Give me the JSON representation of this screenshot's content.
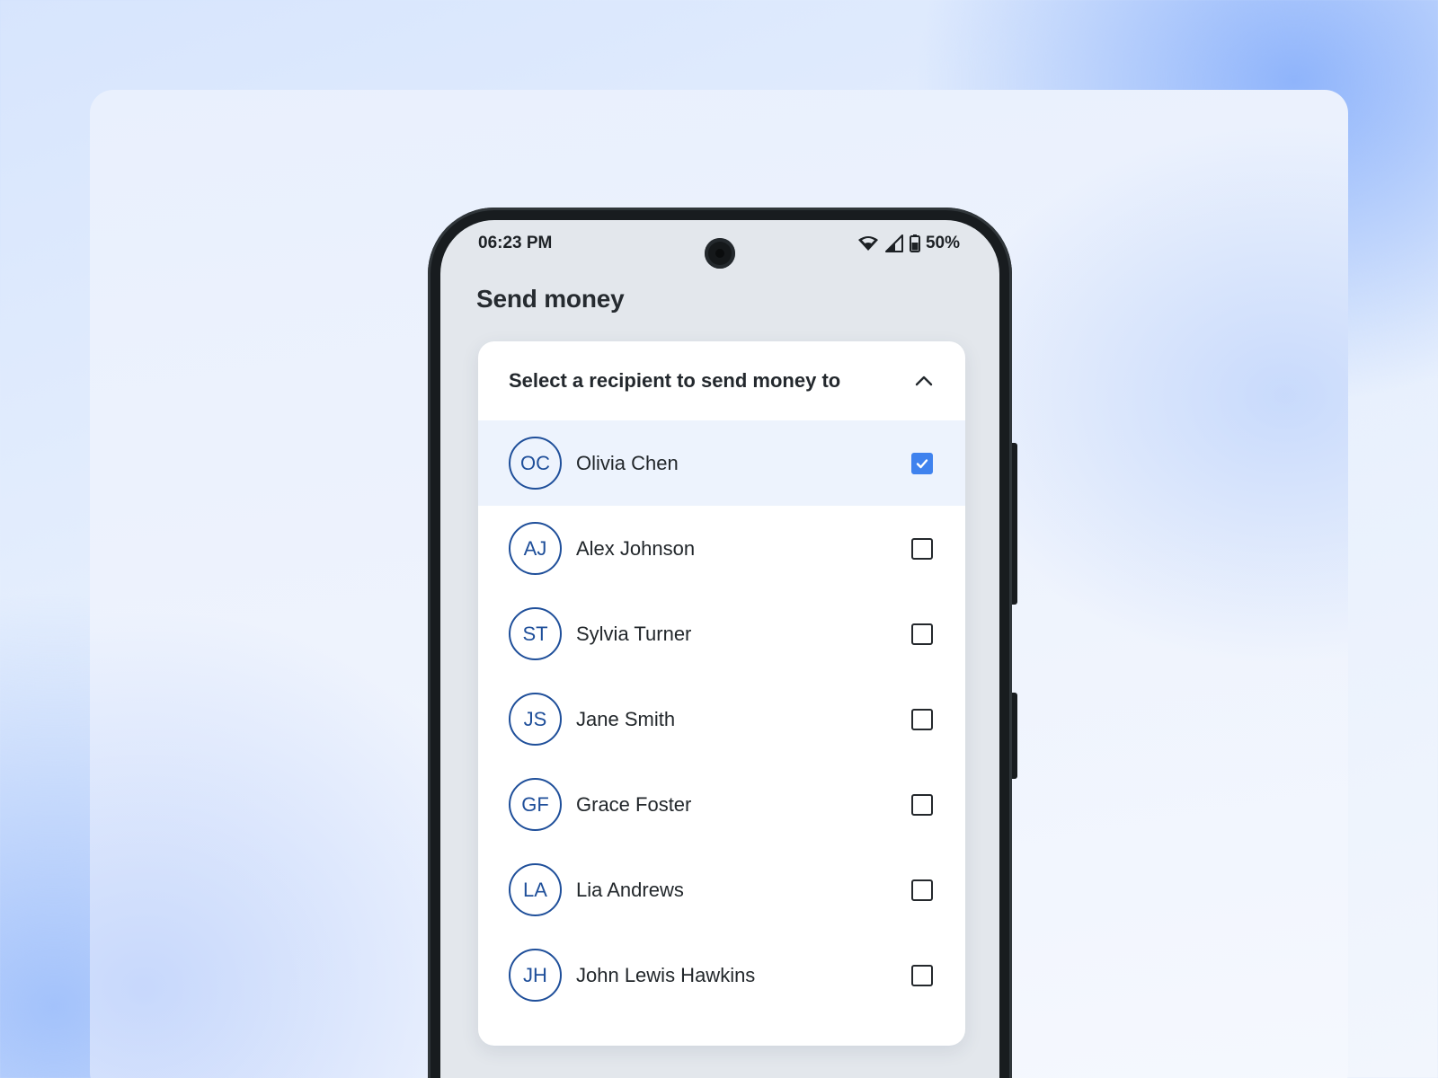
{
  "status_bar": {
    "time": "06:23 PM",
    "battery": "50%",
    "icons": [
      "wifi-icon",
      "cellular-signal-icon",
      "battery-icon"
    ]
  },
  "page": {
    "title": "Send money"
  },
  "recipient_panel": {
    "title": "Select a recipient to send money to",
    "expanded": true,
    "recipients": [
      {
        "initials": "OC",
        "name": "Olivia Chen",
        "selected": true
      },
      {
        "initials": "AJ",
        "name": "Alex Johnson",
        "selected": false
      },
      {
        "initials": "ST",
        "name": "Sylvia Turner",
        "selected": false
      },
      {
        "initials": "JS",
        "name": "Jane Smith",
        "selected": false
      },
      {
        "initials": "GF",
        "name": "Grace Foster",
        "selected": false
      },
      {
        "initials": "LA",
        "name": "Lia Andrews",
        "selected": false
      },
      {
        "initials": "JH",
        "name": "John Lewis Hawkins",
        "selected": false
      }
    ]
  },
  "colors": {
    "accent": "#3f82ee",
    "avatar_ring": "#1f4f9a",
    "selected_row": "#edf3fd",
    "screen_bg": "#e3e7ec"
  }
}
